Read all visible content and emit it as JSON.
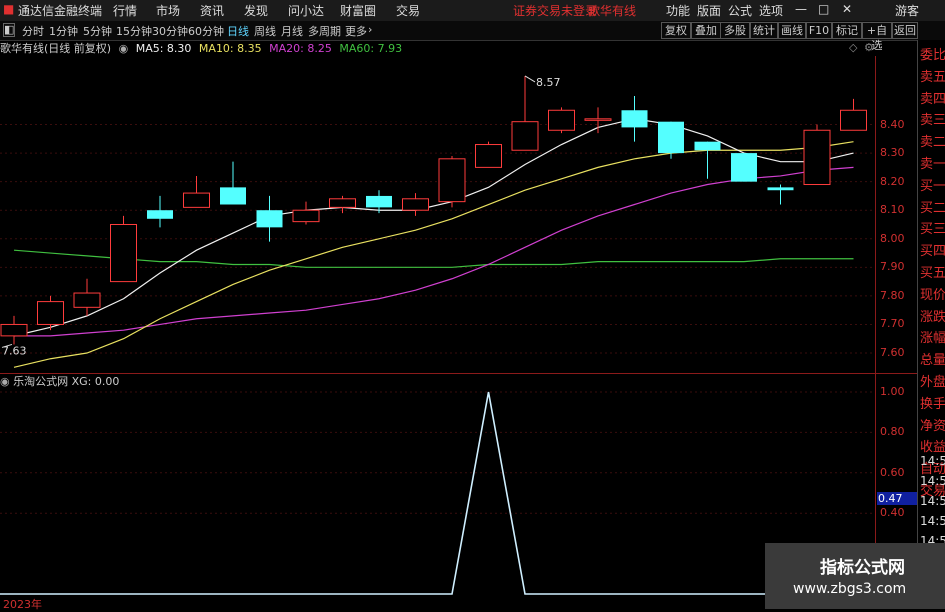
{
  "titlebar": {
    "app_title": "通达信金融终端",
    "menus": [
      "行情",
      "市场",
      "资讯",
      "发现",
      "问小达",
      "财富圈",
      "交易"
    ],
    "notice": "证券交易未登录",
    "stock_name": "歌华有线",
    "right_menus": [
      "功能",
      "版面",
      "公式",
      "选项"
    ],
    "user": "游客",
    "accent": "#e03030"
  },
  "toolbar": {
    "periods": [
      "分时",
      "1分钟",
      "5分钟",
      "15分钟",
      "30分钟",
      "60分钟",
      "日线",
      "周线",
      "月线",
      "多周期",
      "更多"
    ],
    "active_period": "日线",
    "buttons": [
      "复权",
      "叠加",
      "多股",
      "统计",
      "画线",
      "F10",
      "标记",
      "+自选",
      "返回"
    ]
  },
  "info": {
    "title": "歌华有线(日线 前复权)",
    "ma5": "MA5: 8.30",
    "ma10": "MA10: 8.35",
    "ma20": "MA20: 8.25",
    "ma60": "MA60: 7.93",
    "colors": {
      "ma5": "#f0f0f0",
      "ma10": "#e8e060",
      "ma20": "#d040d0",
      "ma60": "#40c040"
    }
  },
  "price_axis": [
    "8.40",
    "8.30",
    "8.20",
    "8.10",
    "8.00",
    "7.90",
    "7.80",
    "7.70",
    "7.60"
  ],
  "annotations": {
    "high": "8.57",
    "low": "7.63"
  },
  "candles": [
    {
      "o": 7.66,
      "c": 7.7,
      "h": 7.73,
      "l": 7.63
    },
    {
      "o": 7.7,
      "c": 7.78,
      "h": 7.8,
      "l": 7.68
    },
    {
      "o": 7.76,
      "c": 7.81,
      "h": 7.86,
      "l": 7.73
    },
    {
      "o": 7.85,
      "c": 8.05,
      "h": 8.08,
      "l": 7.85
    },
    {
      "o": 8.1,
      "c": 8.07,
      "h": 8.15,
      "l": 8.04
    },
    {
      "o": 8.11,
      "c": 8.16,
      "h": 8.22,
      "l": 8.11
    },
    {
      "o": 8.18,
      "c": 8.12,
      "h": 8.27,
      "l": 8.12
    },
    {
      "o": 8.1,
      "c": 8.04,
      "h": 8.15,
      "l": 7.99
    },
    {
      "o": 8.06,
      "c": 8.1,
      "h": 8.13,
      "l": 8.05
    },
    {
      "o": 8.11,
      "c": 8.14,
      "h": 8.15,
      "l": 8.09
    },
    {
      "o": 8.15,
      "c": 8.11,
      "h": 8.17,
      "l": 8.09
    },
    {
      "o": 8.1,
      "c": 8.14,
      "h": 8.16,
      "l": 8.08
    },
    {
      "o": 8.13,
      "c": 8.28,
      "h": 8.29,
      "l": 8.11
    },
    {
      "o": 8.25,
      "c": 8.33,
      "h": 8.34,
      "l": 8.25
    },
    {
      "o": 8.31,
      "c": 8.41,
      "h": 8.57,
      "l": 8.31
    },
    {
      "o": 8.38,
      "c": 8.45,
      "h": 8.46,
      "l": 8.37
    },
    {
      "o": 8.42,
      "c": 8.42,
      "h": 8.46,
      "l": 8.37
    },
    {
      "o": 8.45,
      "c": 8.39,
      "h": 8.5,
      "l": 8.34
    },
    {
      "o": 8.41,
      "c": 8.3,
      "h": 8.41,
      "l": 8.28
    },
    {
      "o": 8.34,
      "c": 8.31,
      "h": 8.34,
      "l": 8.21
    },
    {
      "o": 8.3,
      "c": 8.2,
      "h": 8.3,
      "l": 8.2
    },
    {
      "o": 8.18,
      "c": 8.17,
      "h": 8.19,
      "l": 8.12
    },
    {
      "o": 8.19,
      "c": 8.38,
      "h": 8.4,
      "l": 8.19
    },
    {
      "o": 8.38,
      "c": 8.45,
      "h": 8.49,
      "l": 8.38
    }
  ],
  "ma_series": {
    "ma5": [
      7.66,
      7.69,
      7.73,
      7.79,
      7.88,
      7.96,
      8.02,
      8.08,
      8.1,
      8.11,
      8.1,
      8.1,
      8.13,
      8.18,
      8.26,
      8.33,
      8.39,
      8.42,
      8.4,
      8.36,
      8.3,
      8.27,
      8.27,
      8.3
    ],
    "ma10": [
      7.55,
      7.58,
      7.6,
      7.65,
      7.72,
      7.78,
      7.84,
      7.89,
      7.93,
      7.97,
      8.0,
      8.03,
      8.07,
      8.12,
      8.17,
      8.21,
      8.25,
      8.28,
      8.3,
      8.31,
      8.31,
      8.31,
      8.32,
      8.34
    ],
    "ma20": [
      7.66,
      7.66,
      7.67,
      7.68,
      7.7,
      7.72,
      7.73,
      7.74,
      7.75,
      7.77,
      7.79,
      7.82,
      7.86,
      7.91,
      7.97,
      8.03,
      8.08,
      8.12,
      8.16,
      8.19,
      8.21,
      8.22,
      8.24,
      8.25
    ],
    "ma60": [
      7.96,
      7.95,
      7.94,
      7.93,
      7.92,
      7.92,
      7.91,
      7.91,
      7.9,
      7.9,
      7.9,
      7.9,
      7.9,
      7.91,
      7.91,
      7.91,
      7.92,
      7.92,
      7.92,
      7.92,
      7.92,
      7.93,
      7.93,
      7.93
    ]
  },
  "sub": {
    "title": "乐淘公式网",
    "xg": "XG: 0.00",
    "axis": [
      "1.00",
      "0.80",
      "0.60",
      "0.40"
    ],
    "current": "0.47",
    "signal": [
      0,
      0,
      0,
      0,
      0,
      0,
      0,
      0,
      0,
      0,
      0,
      0,
      0,
      1,
      0,
      0,
      0,
      0,
      0,
      0,
      0,
      0,
      0,
      0
    ],
    "year": "2023年"
  },
  "right_panel": {
    "labels": [
      "委比",
      "卖五",
      "卖四",
      "卖三",
      "卖二",
      "卖一",
      "买一",
      "买二",
      "买三",
      "买四",
      "买五",
      "现价",
      "涨跌",
      "涨幅",
      "总量",
      "外盘",
      "换手",
      "净资",
      "收益",
      "自动",
      "交易"
    ],
    "times": [
      "14:56",
      "14:56",
      "14:56",
      "14:56",
      "14:56",
      "14:56",
      "14:56",
      "14:56"
    ]
  },
  "watermark": {
    "name": "指标公式网",
    "url": "www.zbgs3.com"
  }
}
